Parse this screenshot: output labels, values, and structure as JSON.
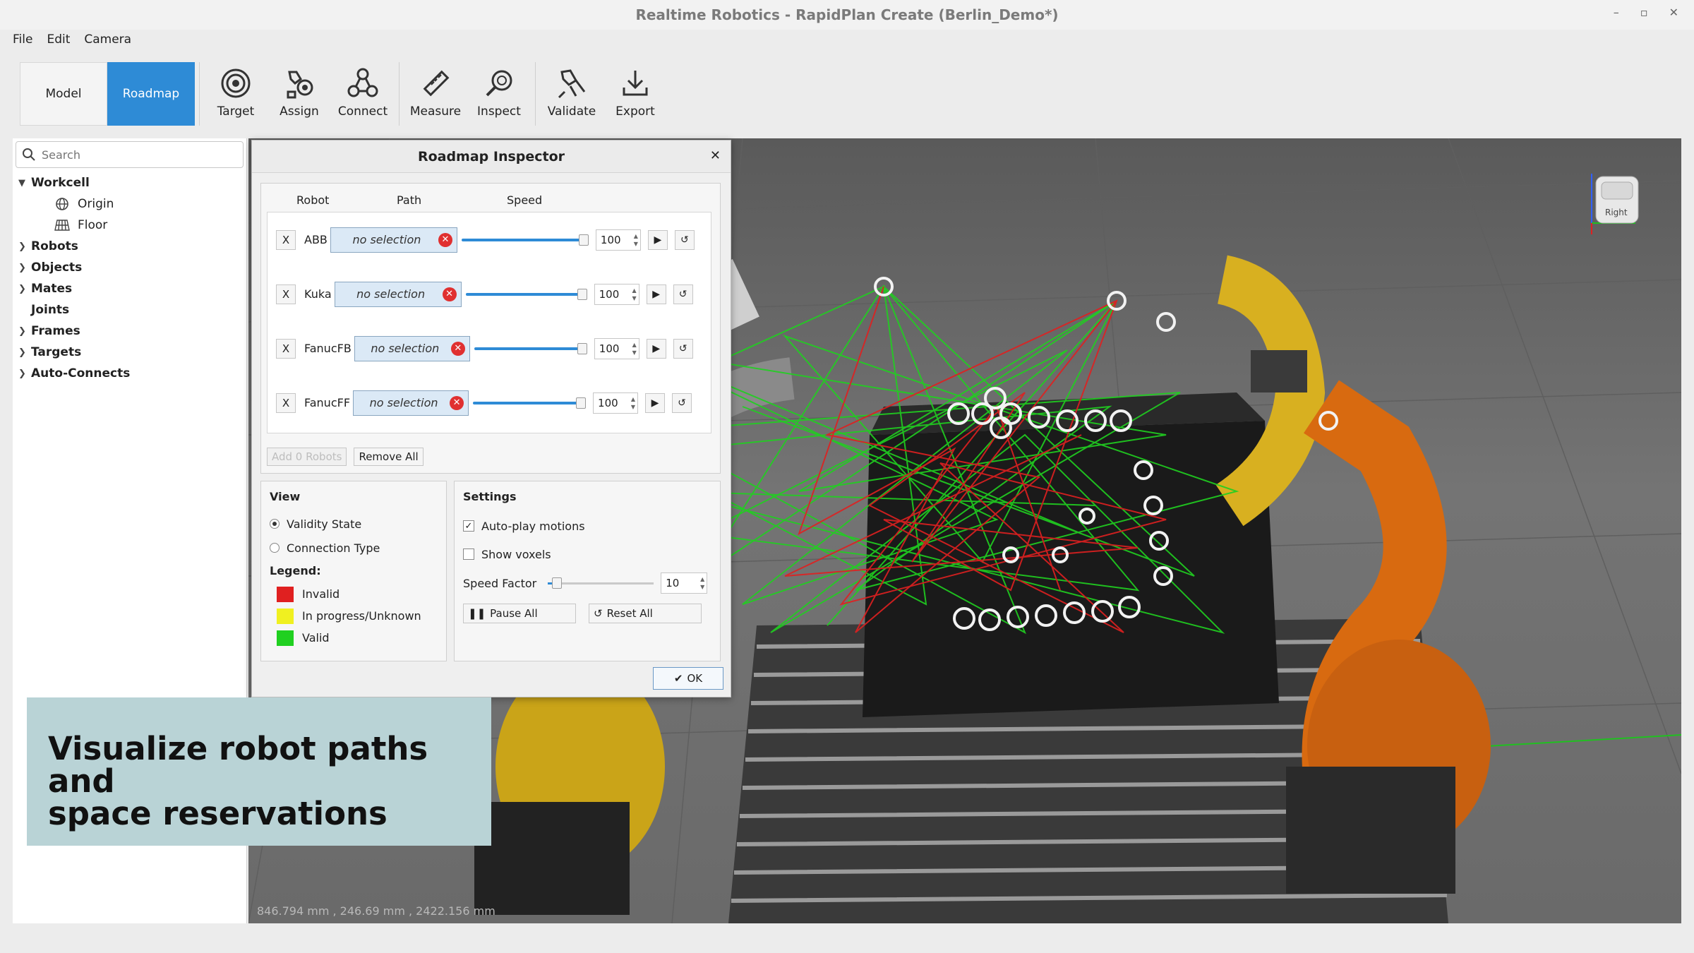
{
  "window": {
    "title": "Realtime Robotics - RapidPlan Create (Berlin_Demo*)",
    "controls": [
      "–",
      "▫",
      "✕"
    ]
  },
  "menu": [
    "File",
    "Edit",
    "Camera"
  ],
  "modes": {
    "model": "Model",
    "roadmap": "Roadmap",
    "active": "Roadmap"
  },
  "tools": [
    {
      "label": "Target",
      "icon": "target-icon"
    },
    {
      "label": "Assign",
      "icon": "assign-icon"
    },
    {
      "label": "Connect",
      "icon": "connect-icon"
    },
    {
      "label": "Measure",
      "icon": "ruler-icon"
    },
    {
      "label": "Inspect",
      "icon": "magnifier-icon"
    },
    {
      "label": "Validate",
      "icon": "validate-icon"
    },
    {
      "label": "Export",
      "icon": "download-icon"
    }
  ],
  "search": {
    "placeholder": "Search"
  },
  "tree": {
    "workcell": "Workcell",
    "children": [
      "Origin",
      "Floor"
    ],
    "groups": [
      "Robots",
      "Objects",
      "Mates",
      "Joints",
      "Frames",
      "Targets",
      "Auto-Connects"
    ]
  },
  "inspector": {
    "title": "Roadmap Inspector",
    "close": "✕",
    "columns": {
      "robot": "Robot",
      "path": "Path",
      "speed": "Speed"
    },
    "robots": [
      {
        "remove": "X",
        "name": "ABB",
        "selection": "no selection",
        "speed": "100",
        "speed_fraction": 1.0
      },
      {
        "remove": "X",
        "name": "Kuka",
        "selection": "no selection",
        "speed": "100",
        "speed_fraction": 1.0
      },
      {
        "remove": "X",
        "name": "FanucFB",
        "selection": "no selection",
        "speed": "100",
        "speed_fraction": 1.0
      },
      {
        "remove": "X",
        "name": "FanucFF",
        "selection": "no selection",
        "speed": "100",
        "speed_fraction": 1.0
      }
    ],
    "add_button": "Add 0 Robots",
    "remove_all": "Remove All",
    "view": {
      "title": "View",
      "options": [
        "Validity State",
        "Connection Type"
      ],
      "selected": "Validity State",
      "legend_title": "Legend:",
      "legend": [
        {
          "label": "Invalid",
          "color": "#e02020"
        },
        {
          "label": "In progress/Unknown",
          "color": "#f0f020"
        },
        {
          "label": "Valid",
          "color": "#20d020"
        }
      ]
    },
    "settings": {
      "title": "Settings",
      "autoplay": "Auto-play motions",
      "autoplay_checked": true,
      "voxels": "Show voxels",
      "voxels_checked": false,
      "speed_factor_label": "Speed Factor",
      "speed_factor": "10",
      "pause_all": "Pause All",
      "reset_all": "Reset All"
    },
    "ok": "OK"
  },
  "viewport": {
    "coords": "846.794 mm , 246.69 mm , 2422.156 mm",
    "navcube_label": "Right"
  },
  "caption": {
    "line1": "Visualize robot paths and",
    "line2": "space reservations"
  },
  "colors": {
    "accent": "#2e8bd6",
    "invalid": "#e02020",
    "valid": "#20d020",
    "robot_yellow": "#d8b020",
    "robot_orange": "#d86a10"
  }
}
